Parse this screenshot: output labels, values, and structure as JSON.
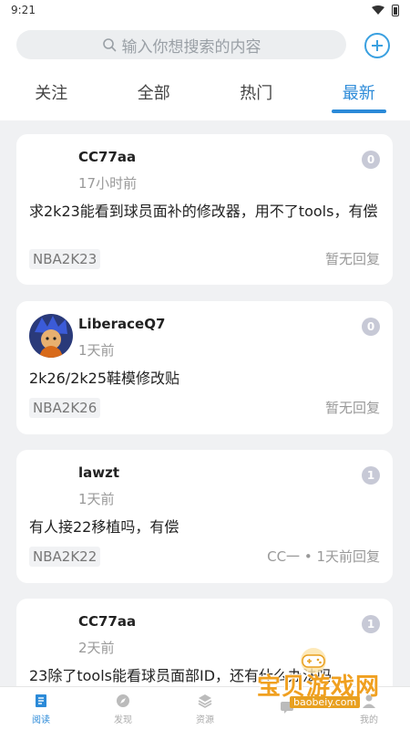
{
  "status_bar": {
    "time": "9:21"
  },
  "search": {
    "placeholder": "输入你想搜索的内容"
  },
  "tabs": [
    {
      "label": "关注",
      "active": false
    },
    {
      "label": "全部",
      "active": false
    },
    {
      "label": "热门",
      "active": false
    },
    {
      "label": "最新",
      "active": true
    }
  ],
  "posts": [
    {
      "username": "CC77aa",
      "time": "17小时前",
      "replies": "0",
      "title": "求2k23能看到球员面补的修改器，用不了tools，有偿",
      "tag": "NBA2K23",
      "reply_status": "暂无回复"
    },
    {
      "username": "LiberaceQ7",
      "time": "1天前",
      "replies": "0",
      "title": "2k26/2k25鞋模修改贴",
      "tag": "NBA2K26",
      "reply_status": "暂无回复"
    },
    {
      "username": "lawzt",
      "time": "1天前",
      "replies": "1",
      "title": "有人接22移植吗，有偿",
      "tag": "NBA2K22",
      "reply_status": "CC一 • 1天前回复"
    },
    {
      "username": "CC77aa",
      "time": "2天前",
      "replies": "1",
      "title": "23除了tools能看球员面部ID，还有什么办法吗"
    }
  ],
  "bottom_nav": [
    {
      "label": "阅读",
      "icon": "book-icon",
      "active": true
    },
    {
      "label": "发现",
      "icon": "compass-icon",
      "active": false
    },
    {
      "label": "资源",
      "icon": "layers-icon",
      "active": false
    },
    {
      "label": "",
      "icon": "message-icon",
      "active": false
    },
    {
      "label": "我的",
      "icon": "user-icon",
      "active": false
    }
  ],
  "watermark": {
    "text": "宝贝游戏网",
    "url": "baobeiy.com"
  },
  "colors": {
    "accent": "#2b8ad8",
    "badge": "#c7c9d6",
    "background": "#f0f1f3"
  }
}
